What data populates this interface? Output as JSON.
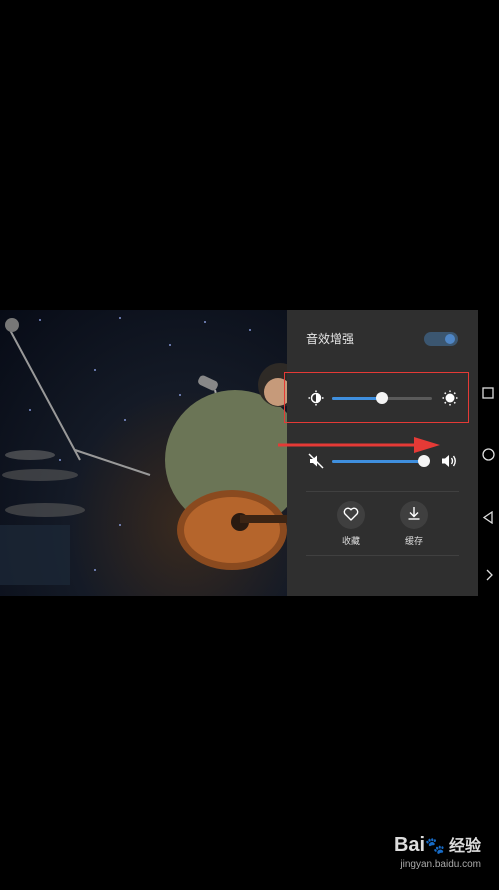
{
  "panel": {
    "title": "音效增强",
    "toggle_on": true,
    "brightness": {
      "value": 0.5
    },
    "volume": {
      "value": 0.96
    },
    "actions": [
      {
        "label": "收藏",
        "icon": "heart-icon"
      },
      {
        "label": "缓存",
        "icon": "download-icon"
      }
    ]
  },
  "colors": {
    "accent": "#3f8fde",
    "panel_bg": "#2f2f2f",
    "highlight": "#e53a36"
  },
  "nav_icons": [
    "recent-apps-icon",
    "home-icon",
    "back-icon",
    "expand-icon"
  ],
  "watermark": {
    "brand": "Bai",
    "brand_suffix": "经验",
    "url": "jingyan.baidu.com"
  }
}
